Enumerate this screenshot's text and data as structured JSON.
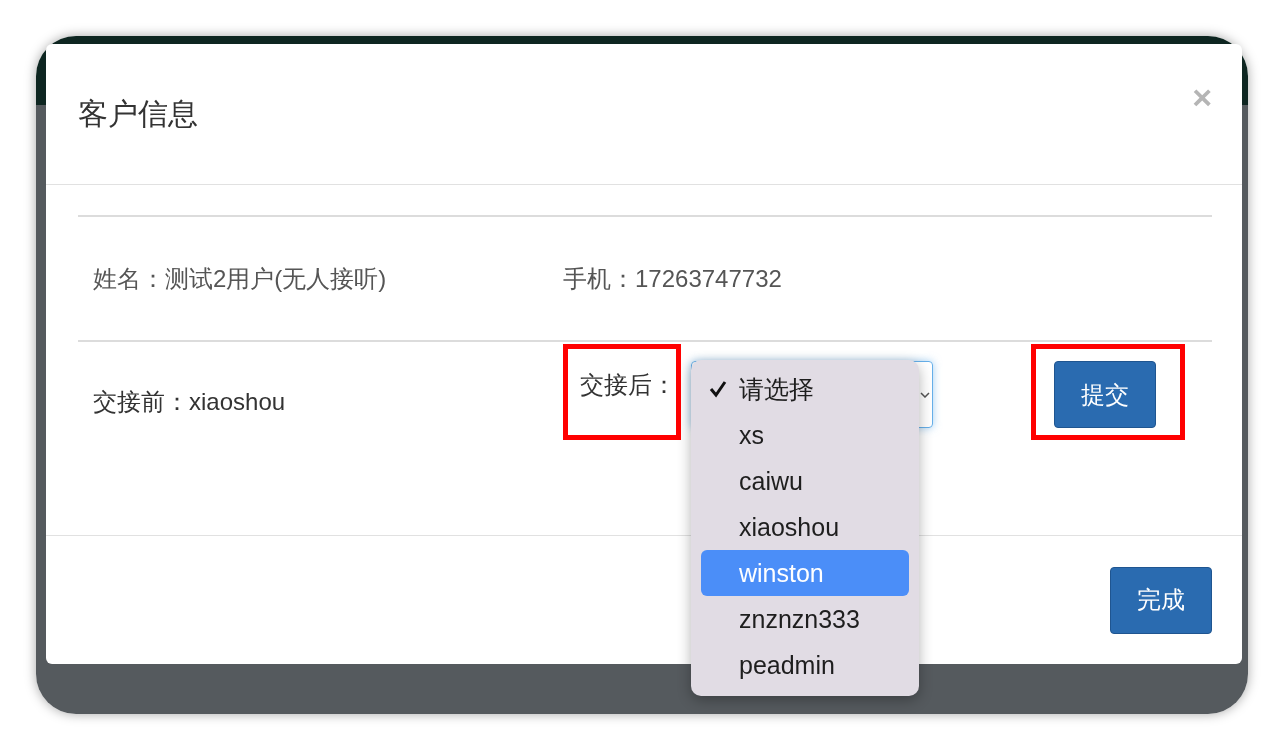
{
  "dialog": {
    "title": "客户信息",
    "close": "×"
  },
  "info": [
    {
      "label": "姓名：",
      "value": "测试2用户(无人接听)"
    },
    {
      "label": "手机：",
      "value": "17263747732"
    }
  ],
  "handover": {
    "before_label": "交接前：",
    "before_value": "xiaoshou",
    "after_label": "交接后：",
    "submit": "提交"
  },
  "dropdown": {
    "options": [
      {
        "label": "请选择",
        "selected": true,
        "highlighted": false
      },
      {
        "label": "xs",
        "selected": false,
        "highlighted": false
      },
      {
        "label": "caiwu",
        "selected": false,
        "highlighted": false
      },
      {
        "label": "xiaoshou",
        "selected": false,
        "highlighted": false
      },
      {
        "label": "winston",
        "selected": false,
        "highlighted": true
      },
      {
        "label": "znznzn333",
        "selected": false,
        "highlighted": false
      },
      {
        "label": "peadmin",
        "selected": false,
        "highlighted": false
      }
    ]
  },
  "footer": {
    "done": "完成"
  }
}
